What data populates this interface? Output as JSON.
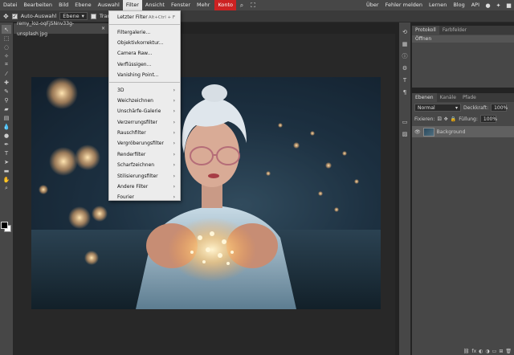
{
  "menubar": {
    "items": [
      "Datei",
      "Bearbeiten",
      "Bild",
      "Ebene",
      "Auswahl",
      "Filter",
      "Ansicht",
      "Fenster",
      "Mehr",
      "Konto"
    ],
    "active": "Filter",
    "right_links": [
      "Über",
      "Fehler melden",
      "Lernen",
      "Blog",
      "API"
    ]
  },
  "options": {
    "auto_select_label": "Auto-Auswahl",
    "layer_select": "Ebene",
    "transform_label": "Transfo"
  },
  "document": {
    "tab_name": "remy_loz-oqFjSNnv33g-unsplash.jpg",
    "close": "×"
  },
  "filter_menu": {
    "group1": [
      {
        "label": "Letzter Filter",
        "shortcut": "Alt+Ctrl + F"
      }
    ],
    "group2": [
      {
        "label": "Filtergalerie..."
      },
      {
        "label": "Objektivkorrektur..."
      },
      {
        "label": "Camera Raw..."
      },
      {
        "label": "Verflüssigen..."
      },
      {
        "label": "Vanishing Point..."
      }
    ],
    "group3": [
      {
        "label": "3D"
      },
      {
        "label": "Weichzeichnen"
      },
      {
        "label": "Unschärfe-Galerie"
      },
      {
        "label": "Verzerrungsfilter"
      },
      {
        "label": "Rauschfilter"
      },
      {
        "label": "Vergröberungsfilter"
      },
      {
        "label": "Renderfilter"
      },
      {
        "label": "Scharfzeichnen"
      },
      {
        "label": "Stilisierungsfilter"
      },
      {
        "label": "Andere Filter"
      },
      {
        "label": "Fourier"
      }
    ],
    "submenu_arrow": "›"
  },
  "history_panel": {
    "tabs": [
      "Protokoll",
      "Farbfelder"
    ],
    "entries": [
      "Öffnen"
    ]
  },
  "layers_panel": {
    "tabs": [
      "Ebenen",
      "Kanäle",
      "Pfade"
    ],
    "blend_mode": "Normal",
    "opacity_label": "Deckkraft:",
    "opacity_value": "100%",
    "lock_label": "Fixieren:",
    "fill_label": "Füllung:",
    "fill_value": "100%",
    "layers": [
      {
        "name": "Background"
      }
    ]
  },
  "colors": {
    "konto_bg": "#cc2222",
    "foreground": "#000000",
    "background": "#ffffff"
  }
}
